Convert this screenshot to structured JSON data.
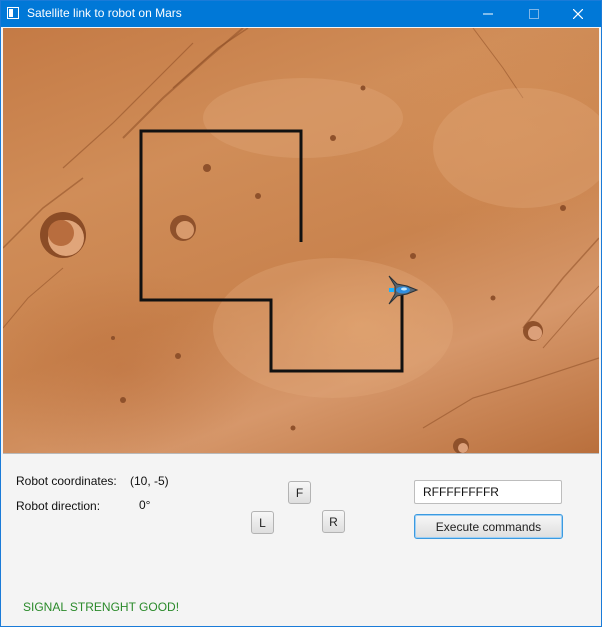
{
  "window": {
    "title": "Satellite link to robot on Mars",
    "controls": {
      "minimize": "—",
      "maximize": "☐",
      "close": "✕"
    }
  },
  "map": {
    "path_color": "#111111",
    "terrain_base_color": "#c9834e",
    "robot_icon": "spaceship-icon"
  },
  "status": {
    "coordinates_label": "Robot coordinates:",
    "coordinates_value": "(10, -5)",
    "direction_label": "Robot direction:",
    "direction_value": "0°",
    "signal_text": "SIGNAL STRENGHT GOOD!",
    "signal_color": "#2a8a2a"
  },
  "controls": {
    "forward_label": "F",
    "left_label": "L",
    "right_label": "R"
  },
  "command": {
    "input_value": "RFFFFFFFFR",
    "execute_label": "Execute commands"
  }
}
